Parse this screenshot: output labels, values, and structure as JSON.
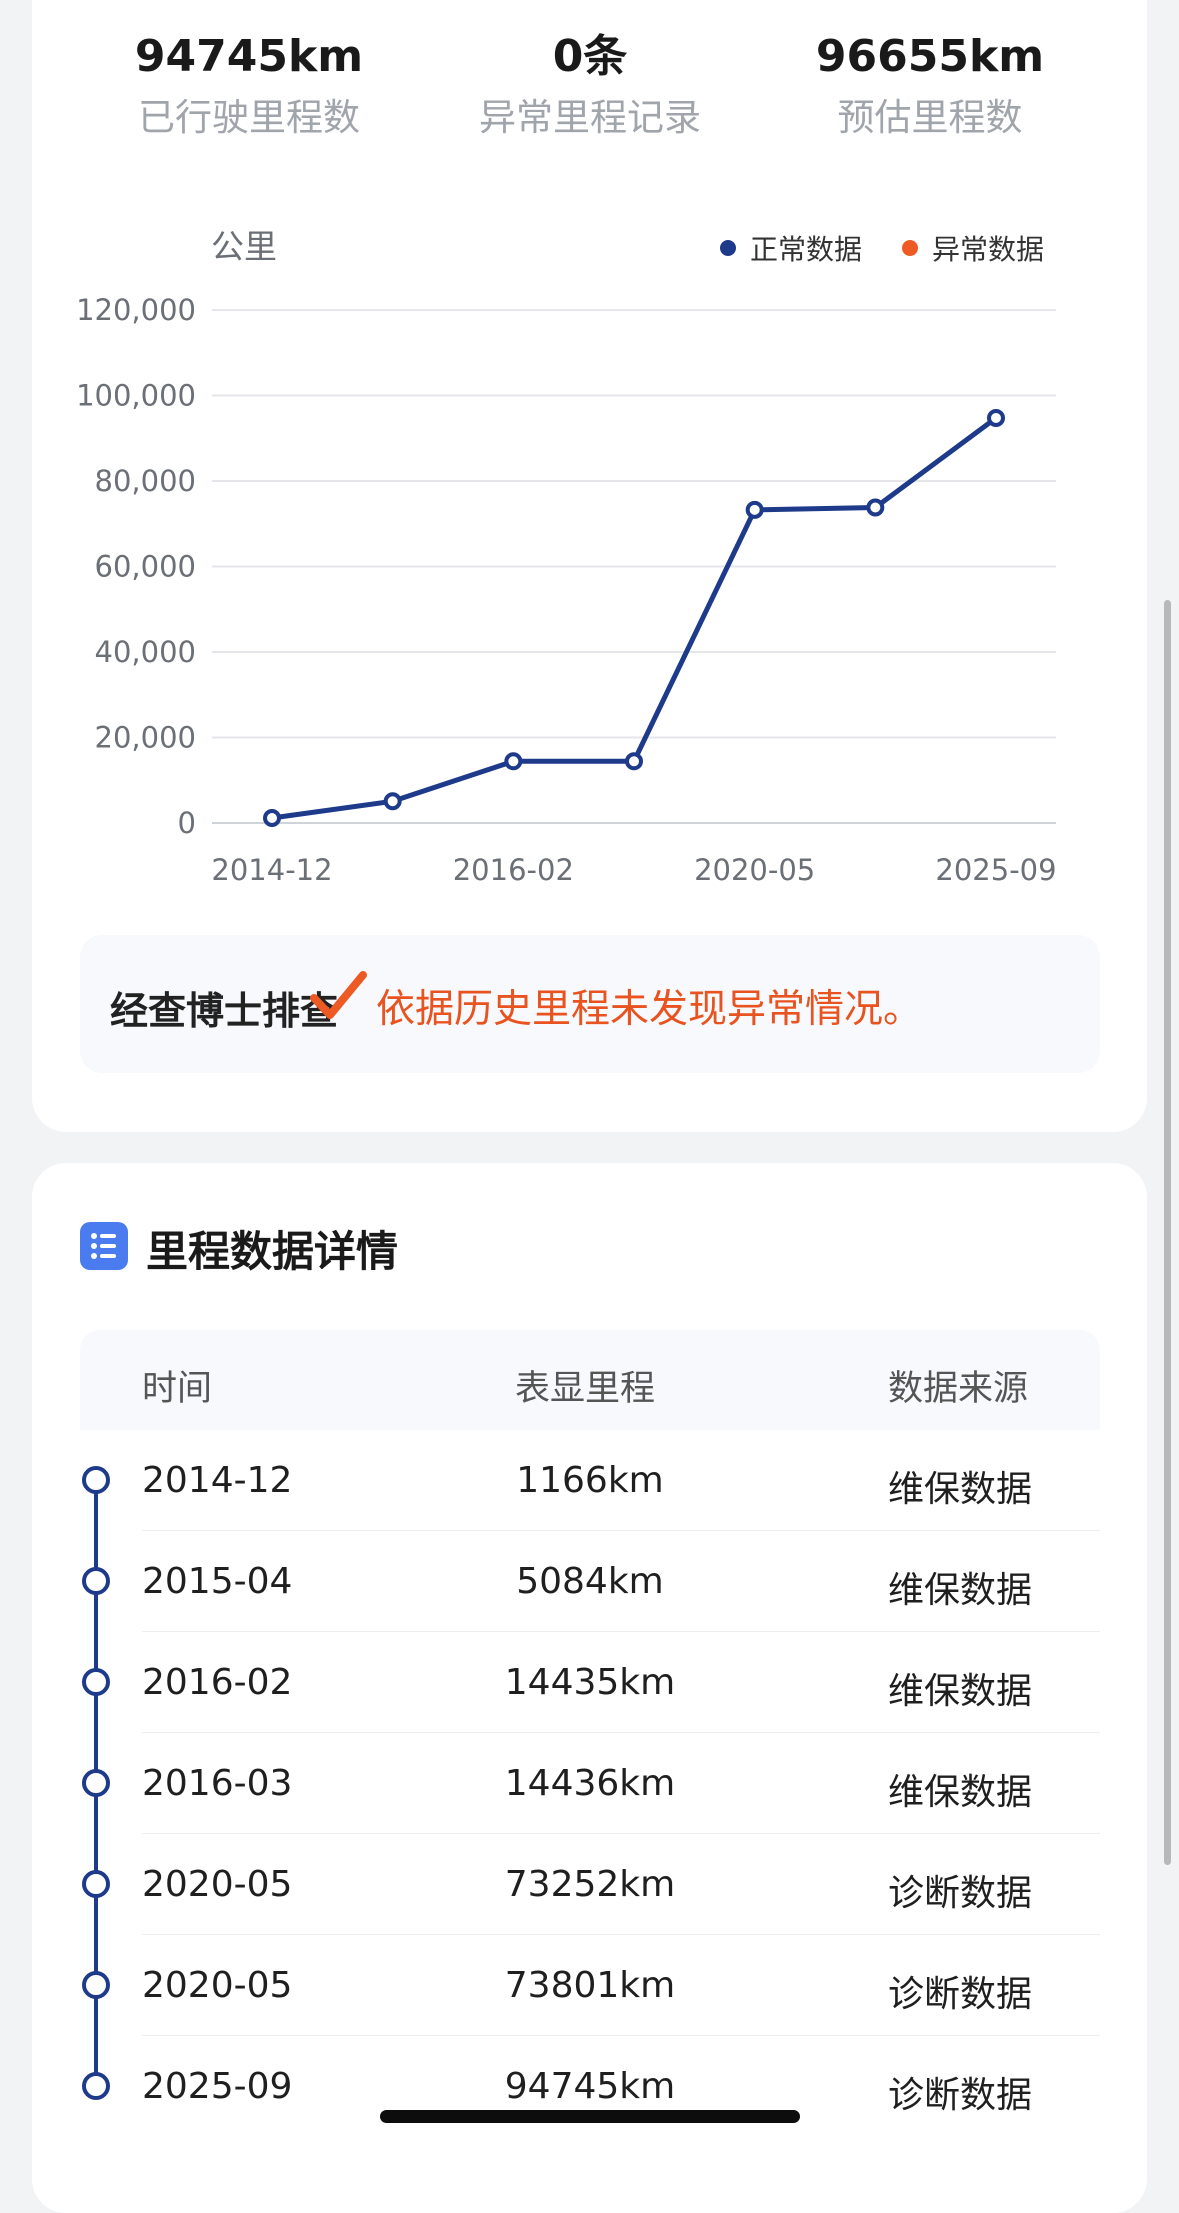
{
  "summary": {
    "driven": {
      "value": "94745km",
      "label": "已行驶里程数"
    },
    "abnormal": {
      "value": "0条",
      "label": "异常里程记录"
    },
    "estimated": {
      "value": "96655km",
      "label": "预估里程数"
    }
  },
  "chart_data": {
    "type": "line",
    "ylabel": "公里",
    "ylim": [
      0,
      120000
    ],
    "yticks": [
      "120,000",
      "100,000",
      "80,000",
      "60,000",
      "40,000",
      "20,000",
      "0"
    ],
    "ytick_values": [
      120000,
      100000,
      80000,
      60000,
      40000,
      20000,
      0
    ],
    "xtick_labels": [
      "2014-12",
      "2016-02",
      "2020-05",
      "2025-09"
    ],
    "legend": [
      {
        "name": "正常数据",
        "color": "#1e3a8a"
      },
      {
        "name": "异常数据",
        "color": "#ee5a24"
      }
    ],
    "legend_position": "top-right",
    "grid": true,
    "series": [
      {
        "name": "正常数据",
        "x": [
          "2014-12",
          "2015-04",
          "2016-02",
          "2016-03",
          "2020-05",
          "2020-05",
          "2025-09"
        ],
        "values": [
          1166,
          5084,
          14435,
          14436,
          73252,
          73801,
          94745
        ]
      }
    ]
  },
  "notice": {
    "brand": "经查博士排查",
    "message": "依据历史里程未发现异常情况。"
  },
  "details": {
    "title": "里程数据详情",
    "headers": [
      "时间",
      "表显里程",
      "数据来源"
    ],
    "rows": [
      [
        "2014-12",
        "1166km",
        "维保数据"
      ],
      [
        "2015-04",
        "5084km",
        "维保数据"
      ],
      [
        "2016-02",
        "14435km",
        "维保数据"
      ],
      [
        "2016-03",
        "14436km",
        "维保数据"
      ],
      [
        "2020-05",
        "73252km",
        "诊断数据"
      ],
      [
        "2020-05",
        "73801km",
        "诊断数据"
      ],
      [
        "2025-09",
        "94745km",
        "诊断数据"
      ]
    ]
  },
  "colors": {
    "primary": "#1e3a8a",
    "accent": "#e8531f",
    "icon": "#4a7cf0"
  }
}
